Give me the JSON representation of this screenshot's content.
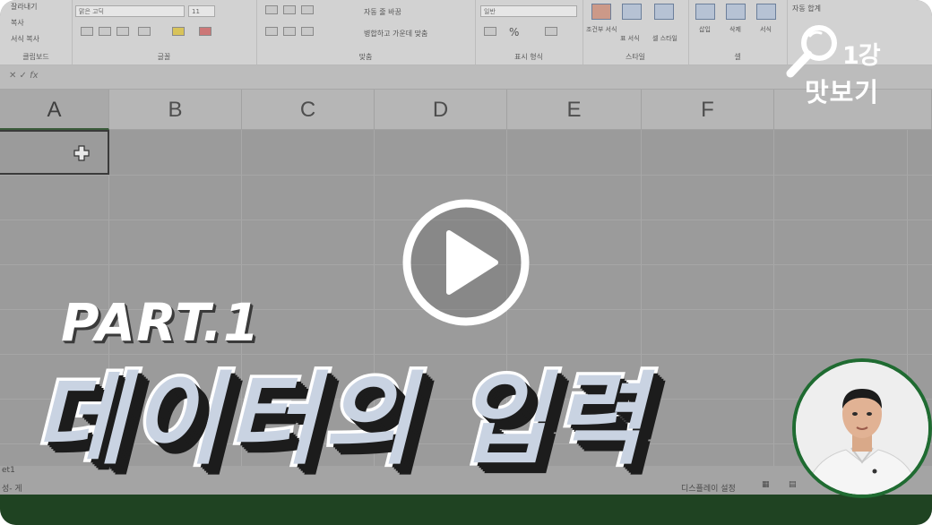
{
  "ribbon": {
    "clipboard": {
      "cut": "잘라내기",
      "copy": "복사",
      "format_painter": "서식 복사",
      "label": "클립보드"
    },
    "font": {
      "name": "맑은 고딕",
      "size": "11",
      "label": "글꼴"
    },
    "alignment": {
      "wrap": "자동 줄 바꿈",
      "merge": "병합하고 가운데 맞춤",
      "label": "맞춤"
    },
    "number": {
      "format": "일반",
      "label": "표시 형식"
    },
    "styles": {
      "conditional": "조건부 서식",
      "table": "표 서식",
      "cell_styles": "셀 스타일",
      "label": "스타일"
    },
    "cells": {
      "insert": "삽입",
      "delete": "삭제",
      "format": "서식",
      "label": "셀"
    },
    "editing": {
      "autosum": "자동 합계"
    }
  },
  "formula_bar": {
    "fx": "fx"
  },
  "columns": [
    "A",
    "B",
    "C",
    "D",
    "E",
    "F"
  ],
  "status_bar": {
    "sheet_tab": "et1",
    "left_text": "성- 게",
    "display_settings": "디스플레이 설정"
  },
  "overlay": {
    "badge_number": "1강",
    "badge_text": "맛보기",
    "part_label": "PART.1",
    "title": "데이터의 입력",
    "play_button": "play"
  },
  "colors": {
    "bottom_bar": "#1f4322",
    "instructor_ring": "#1f6b31",
    "title_fill": "#c9d3e2",
    "title_outline": "#ffffff"
  },
  "icons": [
    "search-magnifier-icon",
    "play-icon",
    "fx-icon",
    "cell-cursor-icon"
  ]
}
